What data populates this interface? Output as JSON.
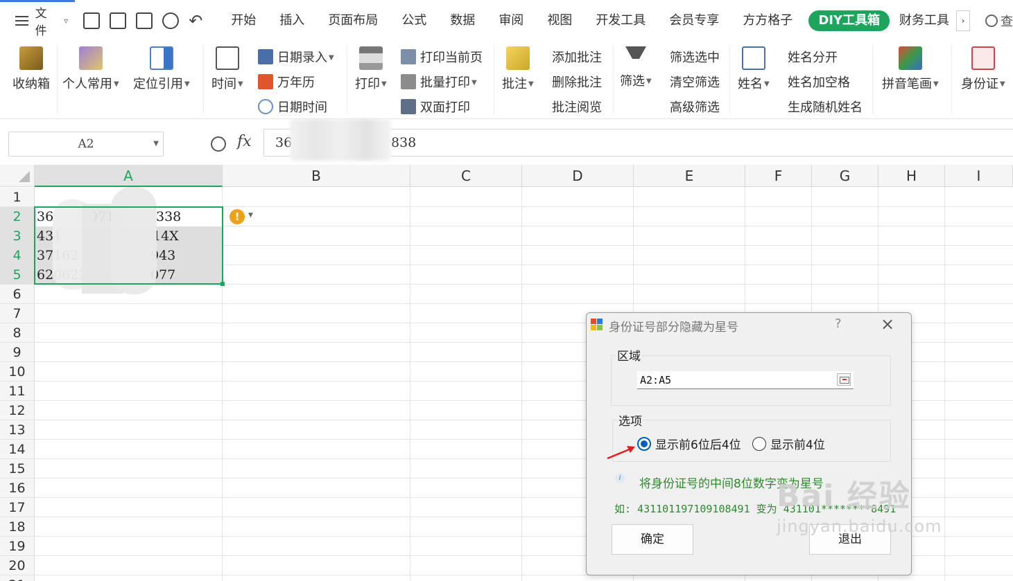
{
  "menubar": {
    "file_label": "文件",
    "tabs": [
      "开始",
      "插入",
      "页面布局",
      "公式",
      "数据",
      "审阅",
      "视图",
      "开发工具",
      "会员专享",
      "方方格子"
    ],
    "active_tab": "DIY工具箱",
    "tab_after": "财务工具",
    "more": "›",
    "search": "查"
  },
  "ribbon": {
    "storage": "收纳箱",
    "personal": "个人常用",
    "locate": "定位引用",
    "time": "时间",
    "date_entry": "日期录入",
    "calendar": "万年历",
    "datetime": "日期时间",
    "print": "打印",
    "print_current": "打印当前页",
    "batch_print": "批量打印",
    "duplex_print": "双面打印",
    "comment": "批注",
    "add_comment": "添加批注",
    "delete_comment": "删除批注",
    "view_comment": "批注阅览",
    "filter": "筛选",
    "filter_selected": "筛选选中",
    "clear_filter": "清空筛选",
    "advanced_filter": "高级筛选",
    "name": "姓名",
    "split_name": "姓名分开",
    "name_space": "姓名加空格",
    "random_name": "生成随机姓名",
    "pinyin": "拼音笔画",
    "id_card": "身份证"
  },
  "formula_bar": {
    "name_box": "A2",
    "fx": "fx",
    "value_start": "36",
    "value_end": "838"
  },
  "sheet": {
    "columns": [
      "A",
      "B",
      "C",
      "D",
      "E",
      "F",
      "G",
      "H",
      "I"
    ],
    "rows": [
      "1",
      "2",
      "3",
      "4",
      "5",
      "6",
      "7",
      "8",
      "9",
      "10",
      "11",
      "12",
      "13",
      "14",
      "15",
      "16",
      "17",
      "18",
      "19",
      "20",
      "21"
    ],
    "cells": [
      {
        "a": "36",
        "b": "071",
        "c": "338"
      },
      {
        "a": "431",
        "b": "",
        "c": "14X"
      },
      {
        "a": "37162",
        "b": "",
        "c": "943"
      },
      {
        "a": "620623",
        "b": "",
        "c": "077"
      }
    ],
    "warning_icon": "!"
  },
  "dialog": {
    "title": "身份证号部分隐藏为星号",
    "help": "?",
    "close": "×",
    "area_label": "区域",
    "range_value": "A2:A5",
    "options_label": "选项",
    "option1": "显示前6位后4位",
    "option2": "显示前4位",
    "hint": "将身份证号的中间8位数字变为星号",
    "example": "如: 431101197109108491 变为 431101********8491",
    "ok": "确定",
    "exit": "退出"
  },
  "watermark": {
    "big": "Bai 经验",
    "small": "jingyan.baidu.com"
  },
  "colors": {
    "accent": "#1da55e",
    "selection_fill": "#dedede",
    "radio_blue": "#005fb8",
    "hint_green": "#2d8a2d",
    "warning_orange": "#f0a11a"
  }
}
